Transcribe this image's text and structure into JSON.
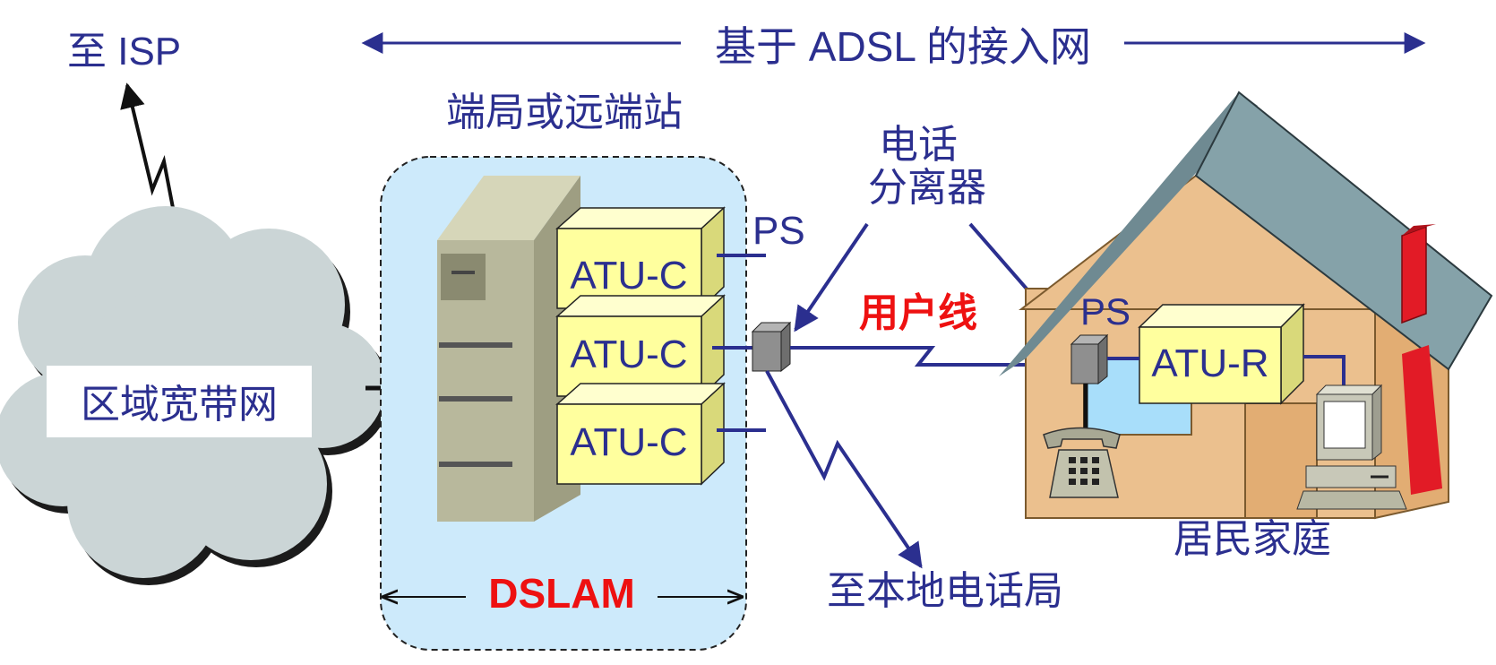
{
  "labels": {
    "to_isp": "至 ISP",
    "adsl_access_network": "基于 ADSL 的接入网",
    "central_office": "端局或远端站",
    "phone_splitter_line1": "电话",
    "phone_splitter_line2": "分离器",
    "ps_left": "PS",
    "ps_right": "PS",
    "subscriber_line": "用户线",
    "regional_broadband": "区域宽带网",
    "atu_c_1": "ATU-C",
    "atu_c_2": "ATU-C",
    "atu_c_3": "ATU-C",
    "atu_r": "ATU-R",
    "residence": "居民家庭",
    "to_local_exchange": "至本地电话局",
    "dslam": "DSLAM"
  },
  "colors": {
    "label_blue": "#2b2f8f",
    "highlight_red": "#ee1111",
    "dslam_zone": "#cdeafb",
    "atu_box": "#ffff9e",
    "cloud": "#cbd5d6",
    "house_wall": "#ebc08e",
    "roof": "#85a2a9",
    "chimney": "#e21b26"
  },
  "icons": [
    "cloud-icon",
    "server-rack-icon",
    "splitter-icon",
    "house-icon",
    "telephone-icon",
    "computer-icon",
    "lightning-link-icon"
  ]
}
